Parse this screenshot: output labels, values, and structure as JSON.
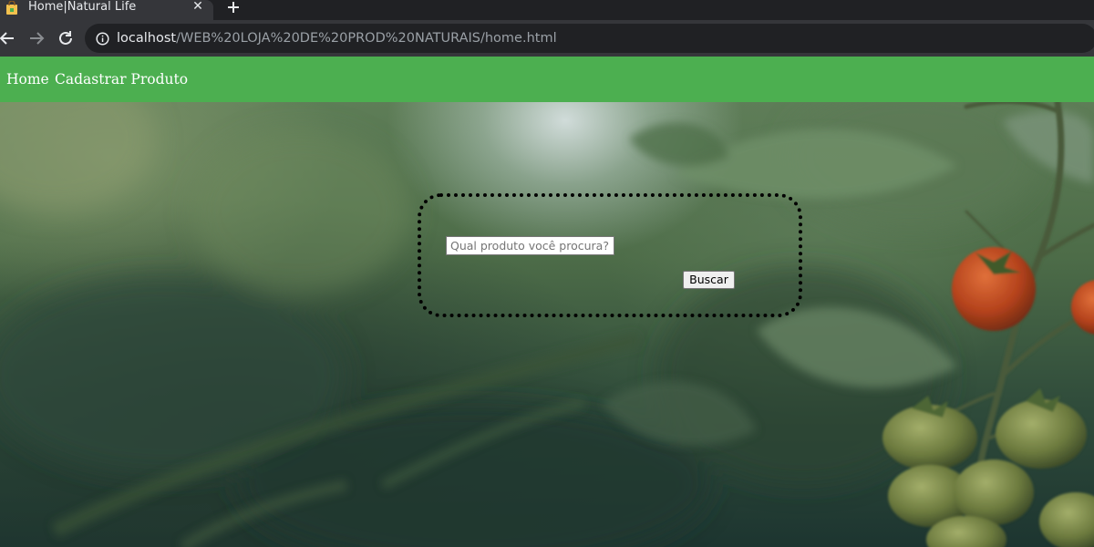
{
  "browser": {
    "tab": {
      "title": "Home|Natural Life",
      "favicon": "shopping-bag-icon",
      "close_icon": "close-icon"
    },
    "new_tab_icon": "plus-icon",
    "nav_icons": [
      "back-arrow-icon",
      "forward-arrow-icon",
      "reload-icon"
    ],
    "address_bar": {
      "security_icon": "info-icon",
      "url_host": "localhost",
      "url_path": "/WEB%20LOJA%20DE%20PROD%20NATURAIS/home.html"
    }
  },
  "page": {
    "navbar": {
      "bg_color": "#4caf50",
      "links": [
        "Home",
        "Cadastrar Produto"
      ]
    },
    "search": {
      "placeholder": "Qual produto você procura?",
      "value": "",
      "button_label": "Buscar"
    },
    "hero_image": "tomato-plant-background"
  }
}
